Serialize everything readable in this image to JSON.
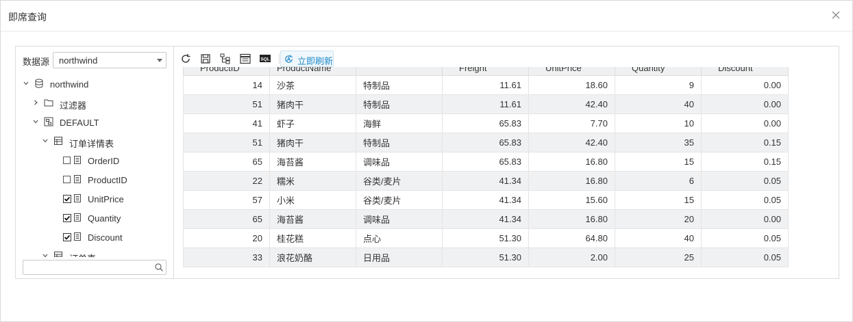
{
  "dialog": {
    "title": "即席查询"
  },
  "datasource": {
    "label": "数据源",
    "selected": "northwind"
  },
  "tree": {
    "root": "northwind",
    "filters": "过滤器",
    "default": "DEFAULT",
    "table": "订单详情表",
    "fields": [
      {
        "name": "OrderID",
        "checked": false
      },
      {
        "name": "ProductID",
        "checked": false
      },
      {
        "name": "UnitPrice",
        "checked": true
      },
      {
        "name": "Quantity",
        "checked": true
      },
      {
        "name": "Discount",
        "checked": true
      }
    ],
    "next_table": "订单表"
  },
  "search": {
    "placeholder": ""
  },
  "toolbar": {
    "icons": [
      "refresh-icon",
      "save-icon",
      "hierarchy-icon",
      "table-view-icon",
      "sql-icon"
    ],
    "sql_text": "SQL",
    "refresh_now_label": "立即刷新"
  },
  "grid": {
    "columns": [
      "ProductID",
      "ProductName",
      "",
      "Freight",
      "UnitPrice",
      "Quantity",
      "Discount"
    ],
    "rows": [
      [
        "14",
        "沙茶",
        "特制品",
        "11.61",
        "18.60",
        "9",
        "0.00"
      ],
      [
        "51",
        "猪肉干",
        "特制品",
        "11.61",
        "42.40",
        "40",
        "0.00"
      ],
      [
        "41",
        "虾子",
        "海鲜",
        "65.83",
        "7.70",
        "10",
        "0.00"
      ],
      [
        "51",
        "猪肉干",
        "特制品",
        "65.83",
        "42.40",
        "35",
        "0.15"
      ],
      [
        "65",
        "海苔酱",
        "调味品",
        "65.83",
        "16.80",
        "15",
        "0.15"
      ],
      [
        "22",
        "糯米",
        "谷类/麦片",
        "41.34",
        "16.80",
        "6",
        "0.05"
      ],
      [
        "57",
        "小米",
        "谷类/麦片",
        "41.34",
        "15.60",
        "15",
        "0.05"
      ],
      [
        "65",
        "海苔酱",
        "调味品",
        "41.34",
        "16.80",
        "20",
        "0.00"
      ],
      [
        "20",
        "桂花糕",
        "点心",
        "51.30",
        "64.80",
        "40",
        "0.05"
      ],
      [
        "33",
        "浪花奶酪",
        "日用品",
        "51.30",
        "2.00",
        "25",
        "0.05"
      ]
    ]
  },
  "colors": {
    "accent": "#1e88c8",
    "header_bg": "#eef0f2",
    "alt_row": "#f0f1f3",
    "border": "#dcdcdc"
  }
}
